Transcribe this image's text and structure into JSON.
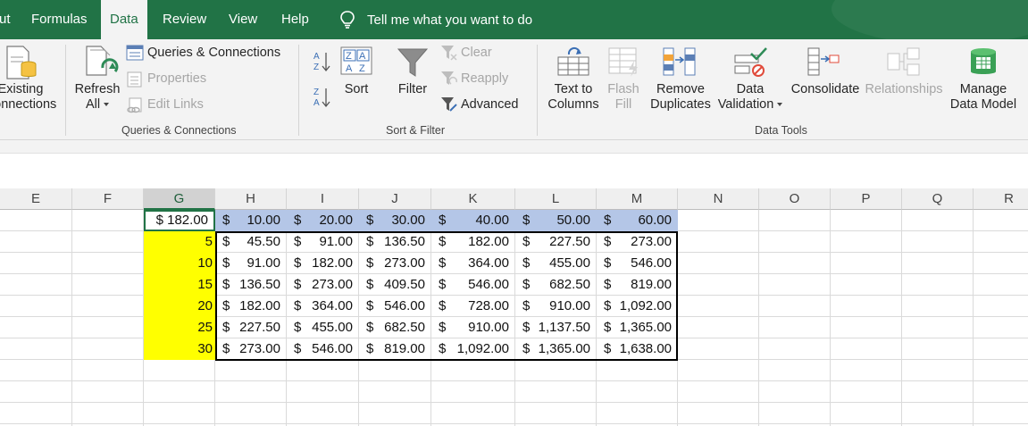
{
  "tabs": [
    {
      "label": "ut",
      "active": false
    },
    {
      "label": "Formulas",
      "active": false
    },
    {
      "label": "Data",
      "active": true
    },
    {
      "label": "Review",
      "active": false
    },
    {
      "label": "View",
      "active": false
    },
    {
      "label": "Help",
      "active": false
    }
  ],
  "tell_me": "Tell me what you want to do",
  "ribbon": {
    "existing_connections": [
      "Existing",
      "Connections"
    ],
    "refresh_all": [
      "Refresh",
      "All"
    ],
    "queries_connections": "Queries & Connections",
    "properties": "Properties",
    "edit_links": "Edit Links",
    "sort": "Sort",
    "filter": "Filter",
    "clear": "Clear",
    "reapply": "Reapply",
    "advanced": "Advanced",
    "text_to_columns": [
      "Text to",
      "Columns"
    ],
    "flash_fill": [
      "Flash",
      "Fill"
    ],
    "remove_duplicates": [
      "Remove",
      "Duplicates"
    ],
    "data_validation": [
      "Data",
      "Validation"
    ],
    "consolidate": "Consolidate",
    "relationships": "Relationships",
    "manage_data_model": [
      "Manage",
      "Data Model"
    ],
    "groups": {
      "queries": "Queries & Connections",
      "sort_filter": "Sort & Filter",
      "data_tools": "Data Tools"
    }
  },
  "columns": [
    "E",
    "F",
    "G",
    "H",
    "I",
    "J",
    "K",
    "L",
    "M",
    "N",
    "O",
    "P",
    "Q",
    "R"
  ],
  "selected_column": "G",
  "sheet": {
    "g_header": "$ 182.00",
    "header_row": [
      "10.00",
      "20.00",
      "30.00",
      "40.00",
      "50.00",
      "60.00"
    ],
    "row_labels": [
      "5",
      "10",
      "15",
      "20",
      "25",
      "30"
    ],
    "rows": [
      [
        "45.50",
        "91.00",
        "136.50",
        "182.00",
        "227.50",
        "273.00"
      ],
      [
        "91.00",
        "182.00",
        "273.00",
        "364.00",
        "455.00",
        "546.00"
      ],
      [
        "136.50",
        "273.00",
        "409.50",
        "546.00",
        "682.50",
        "819.00"
      ],
      [
        "182.00",
        "364.00",
        "546.00",
        "728.00",
        "910.00",
        "1,092.00"
      ],
      [
        "227.50",
        "455.00",
        "682.50",
        "910.00",
        "1,137.50",
        "1,365.00"
      ],
      [
        "273.00",
        "546.00",
        "819.00",
        "1,092.00",
        "1,365.00",
        "1,638.00"
      ]
    ],
    "currency_symbol": "$"
  },
  "colors": {
    "excel_green": "#217346",
    "header_fill": "#b4c6e7",
    "yellow_fill": "#ffff00"
  }
}
